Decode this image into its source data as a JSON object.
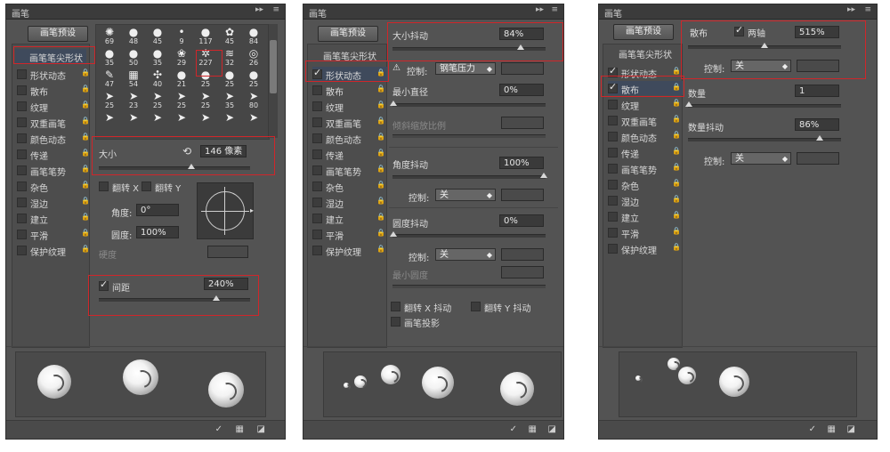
{
  "colors": {
    "panel": "#535353",
    "highlight": "#d0262a",
    "selected": "#3f4a5c"
  },
  "panel1": {
    "title": "画笔",
    "preset_button": "画笔预设",
    "header": "画笔笔尖形状",
    "options": [
      {
        "label": "形状动态",
        "checked": false
      },
      {
        "label": "散布",
        "checked": false
      },
      {
        "label": "纹理",
        "checked": false
      },
      {
        "label": "双重画笔",
        "checked": false
      },
      {
        "label": "颜色动态",
        "checked": false
      },
      {
        "label": "传递",
        "checked": false
      },
      {
        "label": "画笔笔势",
        "checked": false
      },
      {
        "label": "杂色",
        "checked": false
      },
      {
        "label": "湿边",
        "checked": false
      },
      {
        "label": "建立",
        "checked": false
      },
      {
        "label": "平滑",
        "checked": false
      },
      {
        "label": "保护纹理",
        "checked": false
      }
    ],
    "tips": [
      "69",
      "48",
      "45",
      "9",
      "117",
      "45",
      "84",
      "35",
      "50",
      "35",
      "29",
      "227",
      "32",
      "26",
      "47",
      "54",
      "40",
      "21",
      "25",
      "25",
      "25",
      "25",
      "23",
      "25",
      "25",
      "25",
      "35",
      "80",
      "",
      "",
      "",
      "",
      "",
      "",
      ""
    ],
    "size_label": "大小",
    "size_value": "146 像素",
    "flip_x": "翻转 X",
    "flip_y": "翻转 Y",
    "angle_label": "角度:",
    "angle_value": "0°",
    "roundness_label": "圆度:",
    "roundness_value": "100%",
    "hardness_label": "硬度",
    "spacing_label": "间距",
    "spacing_value": "240%"
  },
  "panel2": {
    "title": "画笔",
    "preset_button": "画笔预设",
    "header": "画笔笔尖形状",
    "options": [
      {
        "label": "形状动态",
        "checked": true
      },
      {
        "label": "散布",
        "checked": false
      },
      {
        "label": "纹理",
        "checked": false
      },
      {
        "label": "双重画笔",
        "checked": false
      },
      {
        "label": "颜色动态",
        "checked": false
      },
      {
        "label": "传递",
        "checked": false
      },
      {
        "label": "画笔笔势",
        "checked": false
      },
      {
        "label": "杂色",
        "checked": false
      },
      {
        "label": "湿边",
        "checked": false
      },
      {
        "label": "建立",
        "checked": false
      },
      {
        "label": "平滑",
        "checked": false
      },
      {
        "label": "保护纹理",
        "checked": false
      }
    ],
    "size_jitter_label": "大小抖动",
    "size_jitter_value": "84%",
    "control_label": "控制:",
    "control_value": "钢笔压力",
    "min_diameter_label": "最小直径",
    "min_diameter_value": "0%",
    "tilt_scale_label": "倾斜缩放比例",
    "angle_jitter_label": "角度抖动",
    "angle_jitter_value": "100%",
    "angle_control_label": "控制:",
    "angle_control_value": "关",
    "roundness_jitter_label": "圆度抖动",
    "roundness_jitter_value": "0%",
    "roundness_control_label": "控制:",
    "roundness_control_value": "关",
    "min_roundness_label": "最小圆度",
    "flip_x_jitter": "翻转 X 抖动",
    "flip_y_jitter": "翻转 Y 抖动",
    "brush_projection": "画笔投影"
  },
  "panel3": {
    "title": "画笔",
    "preset_button": "画笔预设",
    "header": "画笔笔尖形状",
    "options": [
      {
        "label": "形状动态",
        "checked": true
      },
      {
        "label": "散布",
        "checked": true
      },
      {
        "label": "纹理",
        "checked": false
      },
      {
        "label": "双重画笔",
        "checked": false
      },
      {
        "label": "颜色动态",
        "checked": false
      },
      {
        "label": "传递",
        "checked": false
      },
      {
        "label": "画笔笔势",
        "checked": false
      },
      {
        "label": "杂色",
        "checked": false
      },
      {
        "label": "湿边",
        "checked": false
      },
      {
        "label": "建立",
        "checked": false
      },
      {
        "label": "平滑",
        "checked": false
      },
      {
        "label": "保护纹理",
        "checked": false
      }
    ],
    "scatter_label": "散布",
    "both_axes_label": "两轴",
    "scatter_value": "515%",
    "control_label": "控制:",
    "control_value": "关",
    "count_label": "数量",
    "count_value": "1",
    "count_jitter_label": "数量抖动",
    "count_jitter_value": "86%",
    "count_control_label": "控制:",
    "count_control_value": "关"
  }
}
